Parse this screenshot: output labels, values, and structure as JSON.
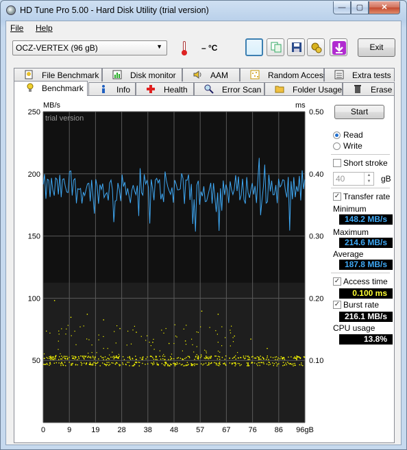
{
  "window": {
    "title": "HD Tune Pro 5.00 - Hard Disk Utility (trial version)"
  },
  "window_buttons": {
    "minimize": "—",
    "maximize": "▢",
    "close": "✕"
  },
  "menu": {
    "file": "File",
    "help": "Help"
  },
  "toolbar": {
    "drive": "OCZ-VERTEX (96 gB)",
    "temperature": "– °C",
    "exit_label": "Exit"
  },
  "tabs_top": [
    {
      "label": "File Benchmark",
      "icon": "file-benchmark-icon"
    },
    {
      "label": "Disk monitor",
      "icon": "disk-monitor-icon"
    },
    {
      "label": "AAM",
      "icon": "speaker-icon"
    },
    {
      "label": "Random Access",
      "icon": "random-access-icon"
    },
    {
      "label": "Extra tests",
      "icon": "extra-tests-icon"
    }
  ],
  "tabs_bottom": [
    {
      "label": "Benchmark",
      "icon": "benchmark-icon"
    },
    {
      "label": "Info",
      "icon": "info-icon"
    },
    {
      "label": "Health",
      "icon": "health-icon"
    },
    {
      "label": "Error Scan",
      "icon": "error-scan-icon"
    },
    {
      "label": "Folder Usage",
      "icon": "folder-icon"
    },
    {
      "label": "Erase",
      "icon": "erase-icon"
    }
  ],
  "controls": {
    "start_label": "Start",
    "read_label": "Read",
    "write_label": "Write",
    "mode": "read",
    "short_stroke_label": "Short stroke",
    "short_stroke_checked": false,
    "short_stroke_value": "40",
    "short_stroke_unit": "gB",
    "transfer_rate_label": "Transfer rate",
    "transfer_rate_checked": true,
    "access_time_label": "Access time",
    "access_time_checked": true,
    "burst_rate_label": "Burst rate",
    "burst_rate_checked": true,
    "cpu_usage_label": "CPU usage"
  },
  "results": {
    "minimum_label": "Minimum",
    "minimum": "148.2 MB/s",
    "maximum_label": "Maximum",
    "maximum": "214.6 MB/s",
    "average_label": "Average",
    "average": "187.8 MB/s",
    "access_time": "0.100 ms",
    "burst_rate": "216.1 MB/s",
    "cpu_usage": "13.8%"
  },
  "chart_data": {
    "type": "line",
    "watermark": "trial version",
    "left_axis": {
      "label": "MB/s",
      "ticks": [
        0,
        50,
        100,
        150,
        200,
        250
      ],
      "range": [
        0,
        250
      ]
    },
    "right_axis": {
      "label": "ms",
      "ticks": [
        "0.10",
        "0.20",
        "0.30",
        "0.40",
        "0.50"
      ],
      "range": [
        0,
        0.5
      ]
    },
    "x_axis": {
      "unit": "gB",
      "ticks": [
        "0",
        "9",
        "19",
        "28",
        "38",
        "48",
        "57",
        "67",
        "76",
        "86",
        "96gB"
      ],
      "range": [
        0,
        96
      ]
    },
    "transfer_rate_color": "#3fa9f5",
    "access_time_color": "#ffff00",
    "transfer_rate_summary": {
      "min": 148.2,
      "max": 214.6,
      "avg": 187.8
    },
    "access_time_typical_ms": [
      0.095,
      0.105
    ],
    "access_time_outliers_ms": [
      0.197,
      0.17,
      0.175,
      0.166,
      0.152,
      0.146,
      0.13,
      0.128,
      0.132,
      0.18,
      0.175,
      0.14,
      0.135,
      0.12
    ]
  },
  "colors": {
    "chart_bg": "#111111",
    "grid": "#5a5a5a",
    "value_blue": "#3fa9f5",
    "value_yellow": "#ffff33"
  }
}
